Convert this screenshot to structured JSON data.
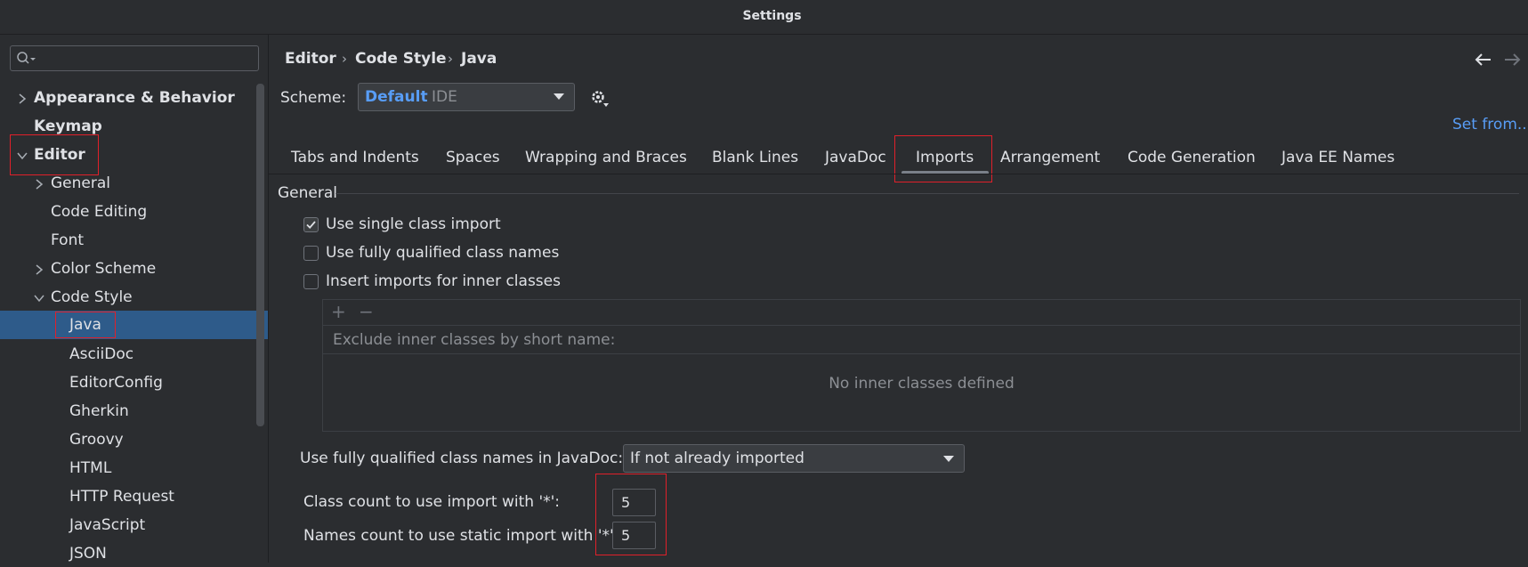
{
  "window": {
    "title": "Settings"
  },
  "search": {
    "placeholder": ""
  },
  "sidebar": {
    "items": [
      {
        "label": "Appearance & Behavior"
      },
      {
        "label": "Keymap"
      },
      {
        "label": "Editor"
      },
      {
        "label": "General"
      },
      {
        "label": "Code Editing"
      },
      {
        "label": "Font"
      },
      {
        "label": "Color Scheme"
      },
      {
        "label": "Code Style"
      },
      {
        "label": "Java"
      },
      {
        "label": "AsciiDoc"
      },
      {
        "label": "EditorConfig"
      },
      {
        "label": "Gherkin"
      },
      {
        "label": "Groovy"
      },
      {
        "label": "HTML"
      },
      {
        "label": "HTTP Request"
      },
      {
        "label": "JavaScript"
      },
      {
        "label": "JSON"
      }
    ]
  },
  "breadcrumb": {
    "items": [
      "Editor",
      "Code Style",
      "Java"
    ]
  },
  "scheme": {
    "label": "Scheme:",
    "name": "Default",
    "scope": "IDE"
  },
  "set_from_link": "Set from...",
  "tabs": [
    {
      "label": "Tabs and Indents"
    },
    {
      "label": "Spaces"
    },
    {
      "label": "Wrapping and Braces"
    },
    {
      "label": "Blank Lines"
    },
    {
      "label": "JavaDoc"
    },
    {
      "label": "Imports",
      "active": true
    },
    {
      "label": "Arrangement"
    },
    {
      "label": "Code Generation"
    },
    {
      "label": "Java EE Names"
    }
  ],
  "general": {
    "section_title": "General",
    "use_single_class_import": {
      "label": "Use single class import",
      "checked": true
    },
    "use_fully_qualified": {
      "label": "Use fully qualified class names",
      "checked": false
    },
    "insert_inner": {
      "label": "Insert imports for inner classes",
      "checked": false
    },
    "exclude_header": "Exclude inner classes by short name:",
    "exclude_empty": "No inner classes defined",
    "javadoc_label": "Use fully qualified class names in JavaDoc:",
    "javadoc_value": "If not already imported",
    "class_count_label": "Class count to use import with '*':",
    "class_count_value": "5",
    "names_count_label": "Names count to use static import with '*':",
    "names_count_value": "5"
  },
  "colors": {
    "accent_selection": "#2e5b8a",
    "link": "#589df6",
    "highlight_box": "#e0202a"
  }
}
